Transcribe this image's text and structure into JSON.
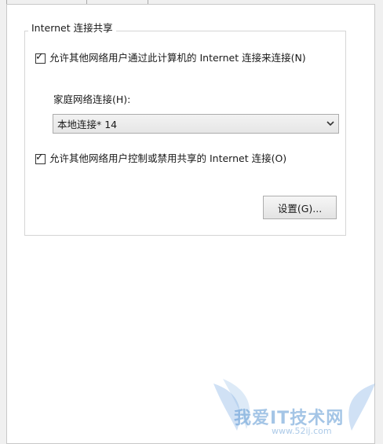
{
  "group": {
    "title": "Internet 连接共享"
  },
  "allow_connect": {
    "checked": true,
    "label": "允许其他网络用户通过此计算机的 Internet 连接来连接(N)"
  },
  "home_network": {
    "label": "家庭网络连接(H):",
    "selected": "本地连接* 14"
  },
  "allow_control": {
    "checked": true,
    "label": "允许其他网络用户控制或禁用共享的 Internet 连接(O)"
  },
  "settings_button": {
    "label": "设置(G)..."
  },
  "watermark": {
    "text": "我爱IT技术网",
    "url": "www.52ij.com",
    "color": "#5a96d2"
  },
  "icons": {
    "check": "checkmark-icon",
    "dropdown": "chevron-down-icon"
  }
}
